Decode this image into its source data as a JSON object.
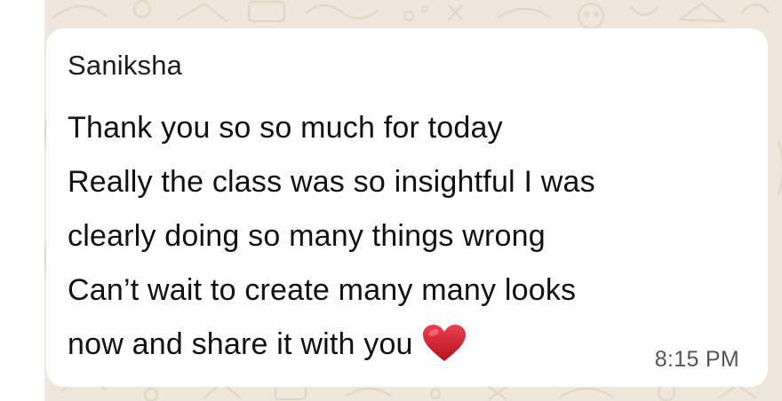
{
  "chat": {
    "background_color": "#efe7dc",
    "bubble_color": "#ffffff"
  },
  "message": {
    "sender": "Saniksha",
    "lines": [
      "Thank you so so much for today",
      "Really the class was so insightful I was",
      "clearly doing so many things wrong",
      "Can’t wait to create many many looks",
      "now and share it with you"
    ],
    "emoji": "heart-icon",
    "emoji_color": "#d6172f",
    "timestamp": "8:15 PM"
  }
}
